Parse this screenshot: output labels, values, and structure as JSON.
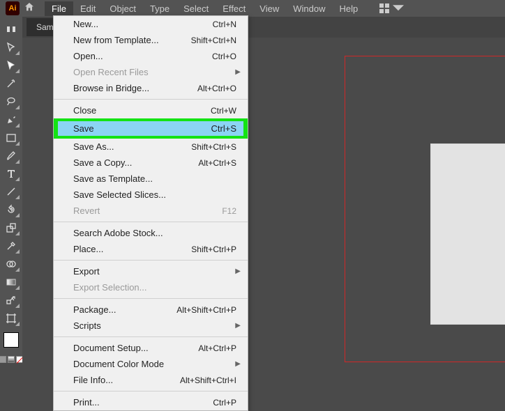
{
  "app": {
    "logo": "Ai"
  },
  "menubar": [
    "File",
    "Edit",
    "Object",
    "Type",
    "Select",
    "Effect",
    "View",
    "Window",
    "Help"
  ],
  "tab": {
    "label": "Sampl"
  },
  "file_menu": {
    "new": {
      "label": "New...",
      "shortcut": "Ctrl+N"
    },
    "new_template": {
      "label": "New from Template...",
      "shortcut": "Shift+Ctrl+N"
    },
    "open": {
      "label": "Open...",
      "shortcut": "Ctrl+O"
    },
    "open_recent": {
      "label": "Open Recent Files"
    },
    "browse_bridge": {
      "label": "Browse in Bridge...",
      "shortcut": "Alt+Ctrl+O"
    },
    "close": {
      "label": "Close",
      "shortcut": "Ctrl+W"
    },
    "save": {
      "label": "Save",
      "shortcut": "Ctrl+S"
    },
    "save_as": {
      "label": "Save As...",
      "shortcut": "Shift+Ctrl+S"
    },
    "save_copy": {
      "label": "Save a Copy...",
      "shortcut": "Alt+Ctrl+S"
    },
    "save_template": {
      "label": "Save as Template..."
    },
    "save_slices": {
      "label": "Save Selected Slices..."
    },
    "revert": {
      "label": "Revert",
      "shortcut": "F12"
    },
    "search_stock": {
      "label": "Search Adobe Stock..."
    },
    "place": {
      "label": "Place...",
      "shortcut": "Shift+Ctrl+P"
    },
    "export": {
      "label": "Export"
    },
    "export_selection": {
      "label": "Export Selection..."
    },
    "package": {
      "label": "Package...",
      "shortcut": "Alt+Shift+Ctrl+P"
    },
    "scripts": {
      "label": "Scripts"
    },
    "doc_setup": {
      "label": "Document Setup...",
      "shortcut": "Alt+Ctrl+P"
    },
    "doc_color": {
      "label": "Document Color Mode"
    },
    "file_info": {
      "label": "File Info...",
      "shortcut": "Alt+Shift+Ctrl+I"
    },
    "print": {
      "label": "Print...",
      "shortcut": "Ctrl+P"
    }
  }
}
